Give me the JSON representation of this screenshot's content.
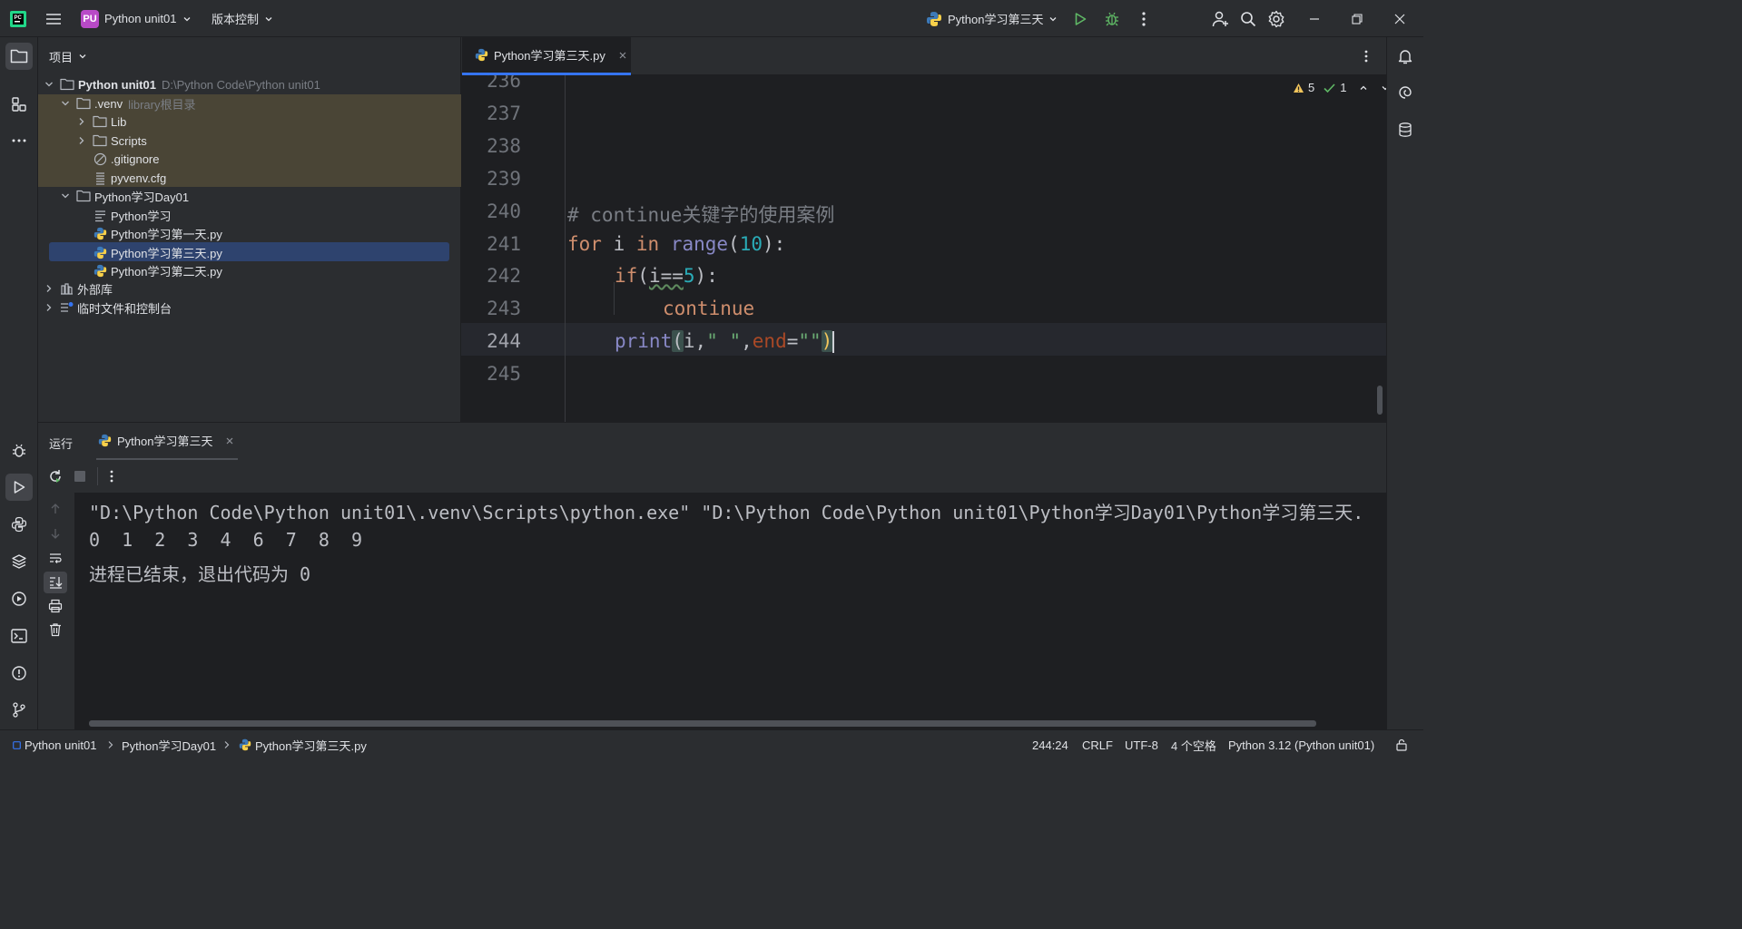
{
  "titlebar": {
    "project_badge": "PU",
    "project_name": "Python unit01",
    "vcs_label": "版本控制",
    "run_config": "Python学习第三天"
  },
  "project_panel": {
    "title": "项目",
    "tree": [
      {
        "label": "Python unit01",
        "hint": "D:\\Python Code\\Python unit01"
      },
      {
        "label": ".venv",
        "hint": "library根目录"
      },
      {
        "label": "Lib"
      },
      {
        "label": "Scripts"
      },
      {
        "label": ".gitignore"
      },
      {
        "label": "pyvenv.cfg"
      },
      {
        "label": "Python学习Day01"
      },
      {
        "label": "Python学习"
      },
      {
        "label": "Python学习第一天.py"
      },
      {
        "label": "Python学习第三天.py"
      },
      {
        "label": "Python学习第二天.py"
      },
      {
        "label": "外部库"
      },
      {
        "label": "临时文件和控制台"
      }
    ]
  },
  "editor": {
    "tab_label": "Python学习第三天.py",
    "warnings": "5",
    "checks": "1",
    "line_numbers": [
      "236",
      "237",
      "238",
      "239",
      "240",
      "241",
      "242",
      "243",
      "244",
      "245"
    ],
    "code": {
      "l240": "# continue关键字的使用案例",
      "l241_for": "for",
      "l241_i": " i ",
      "l241_in": "in",
      "l241_range": "range",
      "l241_num": "10",
      "l242_if": "if",
      "l242_i": "i==",
      "l242_num": "5",
      "l243_continue": "continue",
      "l244_print": "print",
      "l244_i": "i",
      "l244_str1": "\" \"",
      "l244_end": "end",
      "l244_str2": "\"\""
    }
  },
  "run_panel": {
    "label": "运行",
    "tab_label": "Python学习第三天",
    "console": [
      "\"D:\\Python Code\\Python unit01\\.venv\\Scripts\\python.exe\" \"D:\\Python Code\\Python unit01\\Python学习Day01\\Python学习第三天.",
      "0  1  2  3  4  6  7  8  9",
      "进程已结束，退出代码为 0"
    ]
  },
  "statusbar": {
    "crumb1": "Python unit01",
    "crumb2": "Python学习Day01",
    "crumb3": "Python学习第三天.py",
    "position": "244:24",
    "line_sep": "CRLF",
    "encoding": "UTF-8",
    "indent": "4 个空格",
    "interpreter": "Python 3.12 (Python unit01)"
  },
  "colors": {
    "accent": "#3574f0",
    "keyword": "#cf8e6d",
    "builtin": "#8888c6",
    "number": "#2aacb8",
    "string": "#6aab73",
    "comment": "#7a7e85",
    "run_green": "#5fb865"
  }
}
